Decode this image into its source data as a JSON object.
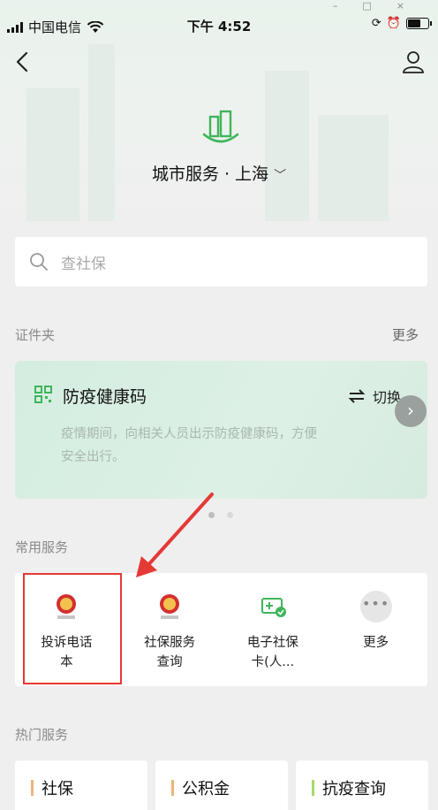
{
  "status_bar": {
    "carrier": "中国电信",
    "time": "下午 4:52"
  },
  "header": {
    "city_title": "城市服务 · 上海"
  },
  "search": {
    "placeholder": "查社保"
  },
  "documents": {
    "label": "证件夹",
    "more": "更多",
    "card": {
      "title": "防疫健康码",
      "switch_label": "切换",
      "description": "疫情期间，向相关人员出示防疫健康码，方便安全出行。"
    }
  },
  "common_services": {
    "label": "常用服务",
    "items": [
      {
        "label": "投诉电话\n本",
        "icon": "national-emblem-icon"
      },
      {
        "label": "社保服务\n查询",
        "icon": "national-emblem-icon"
      },
      {
        "label": "电子社保\n卡(人...",
        "icon": "social-security-card-icon"
      },
      {
        "label": "更多",
        "icon": "more-icon"
      }
    ]
  },
  "hot_services": {
    "label": "热门服务",
    "items": [
      {
        "label": "社保",
        "accent": "#f0b27a"
      },
      {
        "label": "公积金",
        "accent": "#f0b27a"
      },
      {
        "label": "抗疫查询",
        "accent": "#a6d96a"
      }
    ]
  },
  "colors": {
    "brand_green": "#3fb55a",
    "highlight_red": "#e53935"
  }
}
